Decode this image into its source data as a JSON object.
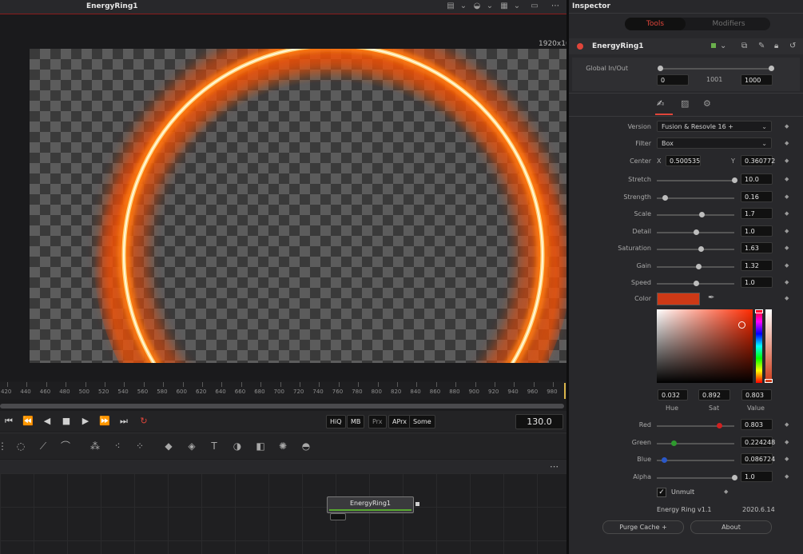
{
  "viewer": {
    "title": "EnergyRing1",
    "resolution": "1920x108",
    "menu_icon": "more-icon"
  },
  "timeline": {
    "ticks": [
      "420",
      "440",
      "460",
      "480",
      "500",
      "520",
      "540",
      "560",
      "580",
      "600",
      "620",
      "640",
      "660",
      "680",
      "700",
      "720",
      "740",
      "760",
      "780",
      "800",
      "820",
      "840",
      "860",
      "880",
      "900",
      "920",
      "940",
      "960",
      "980"
    ],
    "quality_buttons": [
      "HiQ",
      "MB",
      "Prx",
      "APrx",
      "Some"
    ],
    "current_frame": "130.0"
  },
  "node_editor": {
    "node_label": "EnergyRing1"
  },
  "inspector": {
    "title": "Inspector",
    "tabs": {
      "tools": "Tools",
      "modifiers": "Modifiers"
    },
    "tool_name": "EnergyRing1",
    "global_inout": {
      "label": "Global In/Out",
      "start": "0",
      "mid": "1001",
      "end": "1000"
    },
    "version": {
      "label": "Version",
      "value": "Fusion & Resovle 16 +"
    },
    "filter": {
      "label": "Filter",
      "value": "Box"
    },
    "center": {
      "label": "Center",
      "x_label": "X",
      "x": "0.500535",
      "y_label": "Y",
      "y": "0.360772"
    },
    "sliders": [
      {
        "label": "Stretch",
        "value": "10.0",
        "pos": 1.0
      },
      {
        "label": "Strength",
        "value": "0.16",
        "pos": 0.1
      },
      {
        "label": "Scale",
        "value": "1.7",
        "pos": 0.58
      },
      {
        "label": "Detail",
        "value": "1.0",
        "pos": 0.5
      },
      {
        "label": "Saturation",
        "value": "1.63",
        "pos": 0.57
      },
      {
        "label": "Gain",
        "value": "1.32",
        "pos": 0.54
      },
      {
        "label": "Speed",
        "value": "1.0",
        "pos": 0.5
      }
    ],
    "color": {
      "label": "Color",
      "swatch": "#cd3916",
      "hue": "0.032",
      "sat": "0.892",
      "value": "0.803",
      "hue_label": "Hue",
      "sat_label": "Sat",
      "value_label": "Value"
    },
    "channels": [
      {
        "label": "Red",
        "value": "0.803",
        "pos": 0.8,
        "color": "#d02020"
      },
      {
        "label": "Green",
        "value": "0.224248",
        "pos": 0.22,
        "color": "#2e9a2e"
      },
      {
        "label": "Blue",
        "value": "0.086724",
        "pos": 0.09,
        "color": "#2a58c8"
      },
      {
        "label": "Alpha",
        "value": "1.0",
        "pos": 1.0,
        "color": "#bdbdbd"
      }
    ],
    "unmult": {
      "label": "Unmult",
      "checked": true
    },
    "footer": {
      "name": "Energy Ring  v1.1",
      "date": "2020.6.14"
    },
    "buttons": {
      "purge": "Purge Cache +",
      "about": "About"
    }
  }
}
